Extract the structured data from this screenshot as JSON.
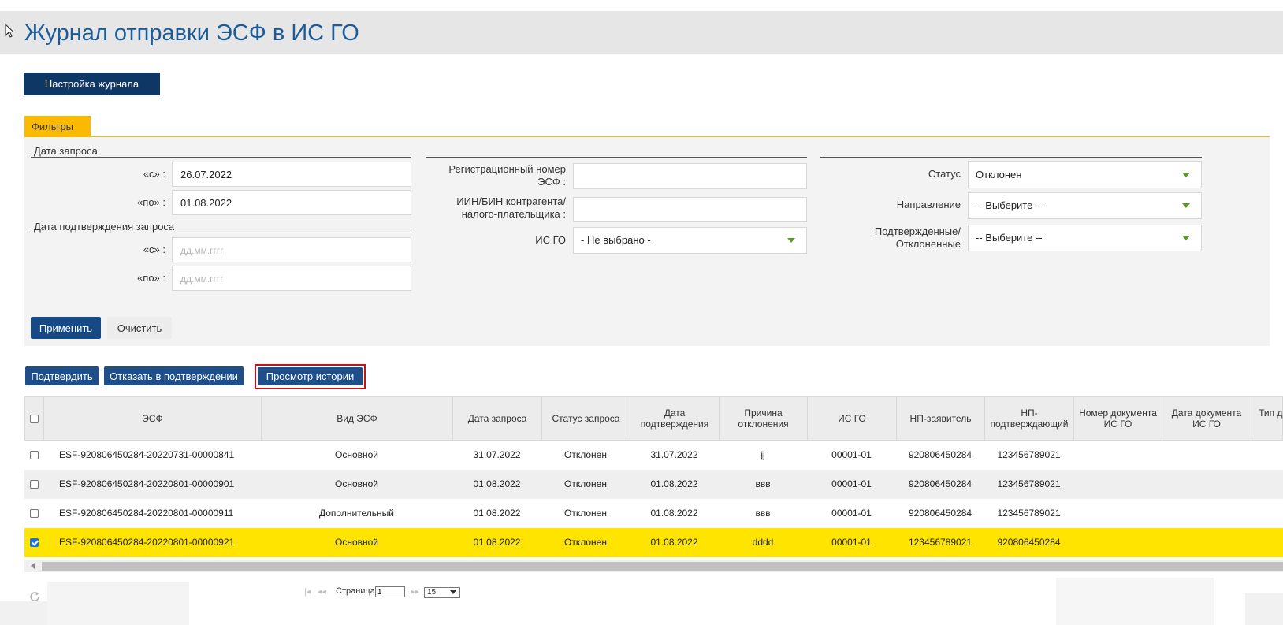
{
  "page": {
    "title": "Журнал отправки ЭСФ в ИС ГО"
  },
  "toolbar": {
    "settings_button": "Настройка журнала"
  },
  "filters": {
    "tab_label": "Фильтры",
    "request_date": {
      "section_title": "Дата запроса",
      "from_label": "«с» :",
      "from_value": "26.07.2022",
      "to_label": "«по» :",
      "to_value": "01.08.2022"
    },
    "confirm_date": {
      "section_title": "Дата подтверждения запроса",
      "from_label": "«с» :",
      "from_placeholder": "дд.мм.гггг",
      "to_label": "«по» :",
      "to_placeholder": "дд.мм.гггг"
    },
    "reg_number": {
      "label_line1": "Регистрационный номер",
      "label_line2": "ЭСФ :",
      "value": ""
    },
    "iin_bin": {
      "label_line1": "ИИН/БИН контрагента/",
      "label_line2": "налого-плательщика :",
      "value": ""
    },
    "is_go": {
      "label": "ИС ГО",
      "selected": "- Не выбрано -"
    },
    "status": {
      "label": "Статус",
      "selected": "Отклонен"
    },
    "direction": {
      "label": "Направление",
      "selected": "-- Выберите --"
    },
    "confirmed": {
      "label_line1": "Подтвержденные/",
      "label_line2": "Отклоненные",
      "selected": "-- Выберите --"
    },
    "apply_button": "Применить",
    "clear_button": "Очистить"
  },
  "actions": {
    "confirm": "Подтвердить",
    "reject": "Отказать в подтверждении",
    "history": "Просмотр истории"
  },
  "table": {
    "columns": [
      "ЭСФ",
      "Вид ЭСФ",
      "Дата запроса",
      "Статус запроса",
      "Дата подтверждения",
      "Причина отклонения",
      "ИС ГО",
      "НП-заявитель",
      "НП-подтверждающий",
      "Номер документа ИС ГО",
      "Дата документа ИС ГО",
      "Тип документа ГО"
    ],
    "rows": [
      {
        "checked": false,
        "selected": false,
        "esf": "ESF-920806450284-20220731-00000841",
        "type": "Основной",
        "req_date": "31.07.2022",
        "status": "Отклонен",
        "confirm_date": "31.07.2022",
        "reason": "jj",
        "is_go": "00001-01",
        "applicant": "920806450284",
        "confirmer": "123456789021",
        "doc_num": "",
        "doc_date": "",
        "doc_type": ""
      },
      {
        "checked": false,
        "selected": false,
        "esf": "ESF-920806450284-20220801-00000901",
        "type": "Основной",
        "req_date": "01.08.2022",
        "status": "Отклонен",
        "confirm_date": "01.08.2022",
        "reason": "ввв",
        "is_go": "00001-01",
        "applicant": "920806450284",
        "confirmer": "123456789021",
        "doc_num": "",
        "doc_date": "",
        "doc_type": ""
      },
      {
        "checked": false,
        "selected": false,
        "esf": "ESF-920806450284-20220801-00000911",
        "type": "Дополнительный",
        "req_date": "01.08.2022",
        "status": "Отклонен",
        "confirm_date": "01.08.2022",
        "reason": "ввв",
        "is_go": "00001-01",
        "applicant": "920806450284",
        "confirmer": "123456789021",
        "doc_num": "",
        "doc_date": "",
        "doc_type": ""
      },
      {
        "checked": true,
        "selected": true,
        "esf": "ESF-920806450284-20220801-00000921",
        "type": "Основной",
        "req_date": "01.08.2022",
        "status": "Отклонен",
        "confirm_date": "01.08.2022",
        "reason": "dddd",
        "is_go": "00001-01",
        "applicant": "123456789021",
        "confirmer": "920806450284",
        "doc_num": "",
        "doc_date": "",
        "doc_type": ""
      }
    ]
  },
  "pager": {
    "page_label": "Страница",
    "page_value": "1",
    "page_size": "15"
  },
  "colors": {
    "title": "#1c5d99",
    "navy": "#0f3766",
    "accent": "#fbb900",
    "selected_row": "#ffe400",
    "highlight_border": "#c0141b"
  }
}
